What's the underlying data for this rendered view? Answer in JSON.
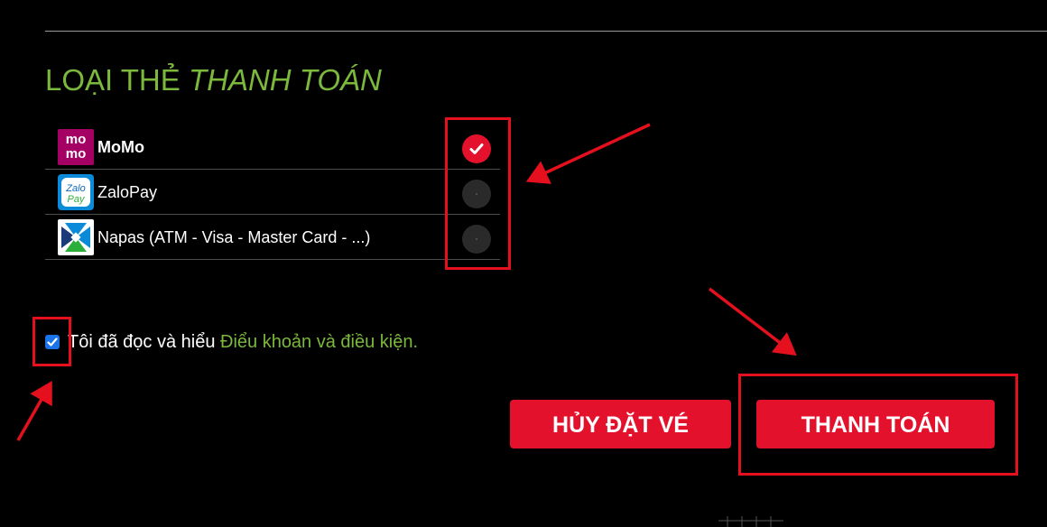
{
  "section": {
    "title_plain": "LOẠI THẺ ",
    "title_italic": "THANH TOÁN"
  },
  "payment_methods": [
    {
      "name": "MoMo",
      "logo": "momo-logo",
      "logo_text": [
        "mo",
        "mo"
      ],
      "selected": true
    },
    {
      "name": "ZaloPay",
      "logo": "zalopay-logo",
      "logo_text": [
        "Zalo",
        "Pay"
      ],
      "selected": false
    },
    {
      "name": "Napas (ATM - Visa - Master Card - ...)",
      "logo": "napas-logo",
      "selected": false
    }
  ],
  "terms": {
    "checked": true,
    "text": "Tôi đã đọc và hiểu ",
    "link": "Điểu khoản và điều kiện."
  },
  "buttons": {
    "cancel": "HỦY ĐẶT VÉ",
    "pay": "THANH TOÁN"
  },
  "colors": {
    "accent_green": "#7bb83c",
    "button_red": "#e4112c",
    "annotation_red": "#e4101d",
    "background": "#000000"
  }
}
